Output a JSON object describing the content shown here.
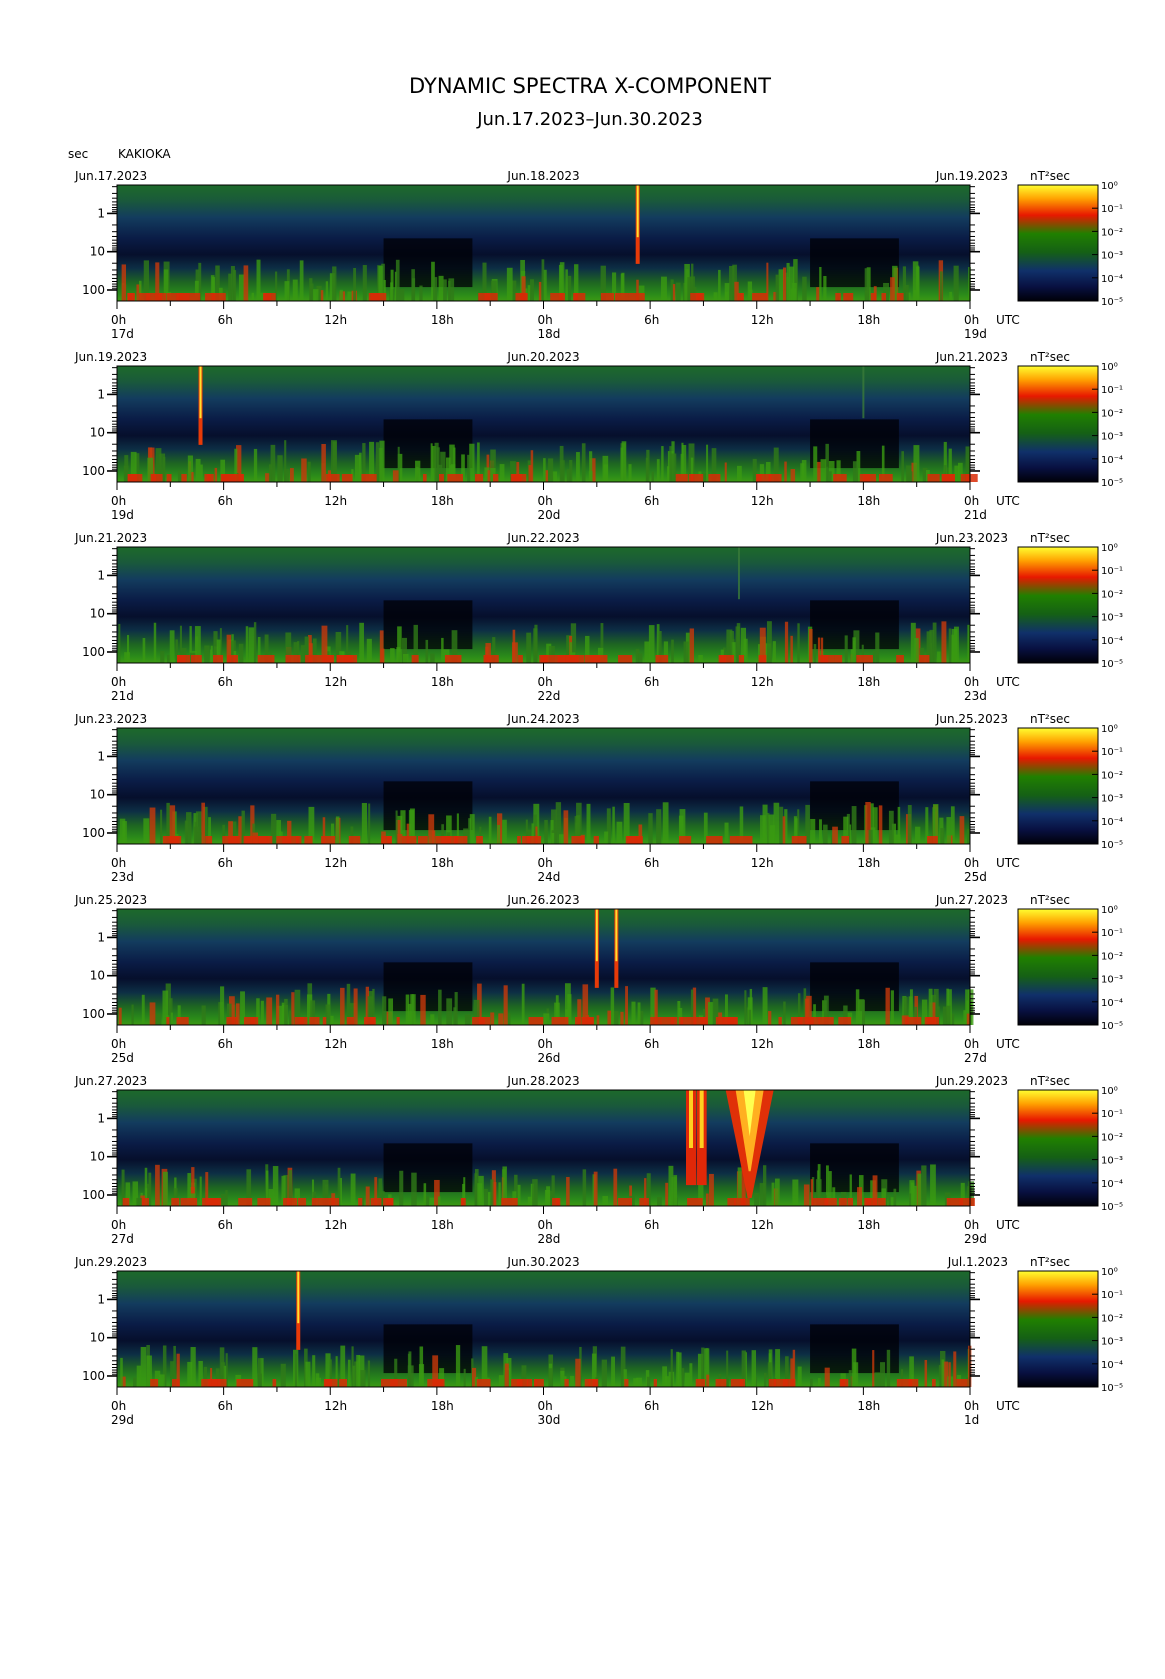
{
  "title": "DYNAMIC SPECTRA X-COMPONENT",
  "subtitle": "Jun.17.2023–Jun.30.2023",
  "station": "KAKIOKA",
  "y_unit": "sec",
  "x_unit": "UTC",
  "colorbar_unit": "nT²sec",
  "chart_data": {
    "type": "heatmap",
    "title": "DYNAMIC SPECTRA X-COMPONENT",
    "subtitle": "Jun.17.2023–Jun.30.2023",
    "ylabel": "sec",
    "xlabel": "UTC",
    "y_scale": "log",
    "y_ticks": [
      "1",
      "10",
      "100"
    ],
    "x_ticks": [
      "0h",
      "6h",
      "12h",
      "18h",
      "0h",
      "6h",
      "12h",
      "18h",
      "0h"
    ],
    "color_scale": {
      "label": "nT²sec",
      "scale": "log",
      "ticks": [
        "10⁰",
        "10⁻¹",
        "10⁻²",
        "10⁻³",
        "10⁻⁴",
        "10⁻⁵"
      ],
      "colors": [
        "#ffff30",
        "#ff8800",
        "#e01000",
        "#208000",
        "#102060",
        "#000008"
      ]
    },
    "panels": [
      {
        "left_date": "Jun.17.2023",
        "mid_date": "Jun.18.2023",
        "right_date": "Jun.19.2023",
        "day_labels": [
          "17d",
          "18d",
          "19d"
        ],
        "events": [
          {
            "hour": 29.3,
            "type": "spike"
          }
        ]
      },
      {
        "left_date": "Jun.19.2023",
        "mid_date": "Jun.20.2023",
        "right_date": "Jun.21.2023",
        "day_labels": [
          "19d",
          "20d",
          "21d"
        ],
        "events": [
          {
            "hour": 4.7,
            "type": "spike"
          },
          {
            "hour": 42.0,
            "type": "faint"
          }
        ]
      },
      {
        "left_date": "Jun.21.2023",
        "mid_date": "Jun.22.2023",
        "right_date": "Jun.23.2023",
        "day_labels": [
          "21d",
          "22d",
          "23d"
        ],
        "events": [
          {
            "hour": 35.0,
            "type": "faint"
          }
        ]
      },
      {
        "left_date": "Jun.23.2023",
        "mid_date": "Jun.24.2023",
        "right_date": "Jun.25.2023",
        "day_labels": [
          "23d",
          "24d",
          "25d"
        ],
        "events": []
      },
      {
        "left_date": "Jun.25.2023",
        "mid_date": "Jun.26.2023",
        "right_date": "Jun.27.2023",
        "day_labels": [
          "25d",
          "26d",
          "27d"
        ],
        "events": [
          {
            "hour": 27.0,
            "type": "spike"
          },
          {
            "hour": 28.1,
            "type": "spike"
          }
        ]
      },
      {
        "left_date": "Jun.27.2023",
        "mid_date": "Jun.28.2023",
        "right_date": "Jun.29.2023",
        "day_labels": [
          "27d",
          "28d",
          "29d"
        ],
        "events": [
          {
            "hour": 32.3,
            "type": "storm"
          },
          {
            "hour": 32.9,
            "type": "storm"
          },
          {
            "hour": 35.6,
            "type": "storm-wide"
          }
        ]
      },
      {
        "left_date": "Jun.29.2023",
        "mid_date": "Jun.30.2023",
        "right_date": "Jul.1.2023",
        "day_labels": [
          "29d",
          "30d",
          "1d"
        ],
        "events": [
          {
            "hour": 10.2,
            "type": "spike"
          }
        ]
      }
    ]
  }
}
